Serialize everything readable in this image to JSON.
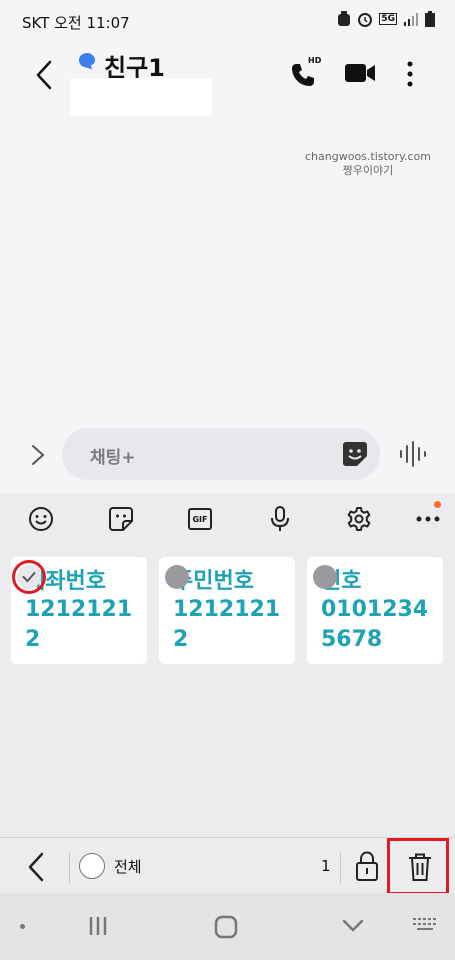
{
  "status_bar": {
    "carrier_time": "SKT  오전 11:07",
    "network": "5G"
  },
  "header": {
    "contact_name": "친구1",
    "call_badge": "HD"
  },
  "watermark": {
    "line1": "changwoos.tistory.com",
    "line2": "짱우이야기"
  },
  "composer": {
    "placeholder": "채팅+"
  },
  "keyboard_toolbar": {
    "gif_label": "GIF"
  },
  "clipboard": {
    "items": [
      {
        "title": "계좌번호",
        "value": "12121212",
        "selected": true
      },
      {
        "title": "주민번호",
        "value": "12121212",
        "selected": false
      },
      {
        "title": "번호",
        "value": "0101234 5678",
        "selected": false
      }
    ]
  },
  "action_bar": {
    "select_all_label": "전체",
    "selected_count": "1"
  },
  "colors": {
    "accent": "#1ea2b5",
    "highlight": "#e01a22",
    "notification": "#f26b2d"
  }
}
